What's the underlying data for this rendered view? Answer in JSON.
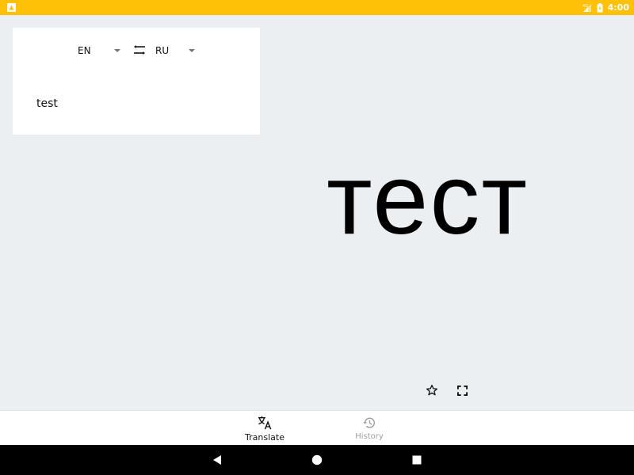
{
  "status_bar": {
    "time": "4:00",
    "icons": [
      "app-notification-icon",
      "signal-icon",
      "battery-icon"
    ],
    "background_color": "#ffc107"
  },
  "language_bar": {
    "source_language": "EN",
    "target_language": "RU",
    "swap_icon": "swap-horiz-icon",
    "dropdown_icon": "arrow-drop-down-icon"
  },
  "input": {
    "text": "test"
  },
  "output": {
    "translation": "тест",
    "actions": [
      "star-outline-icon",
      "fullscreen-icon"
    ]
  },
  "bottom_nav": {
    "items": [
      {
        "label": "Translate",
        "icon": "translate-icon",
        "active": true
      },
      {
        "label": "History",
        "icon": "history-icon",
        "active": false
      }
    ]
  },
  "system_nav": {
    "buttons": [
      "back-icon",
      "home-icon",
      "recents-icon"
    ]
  }
}
